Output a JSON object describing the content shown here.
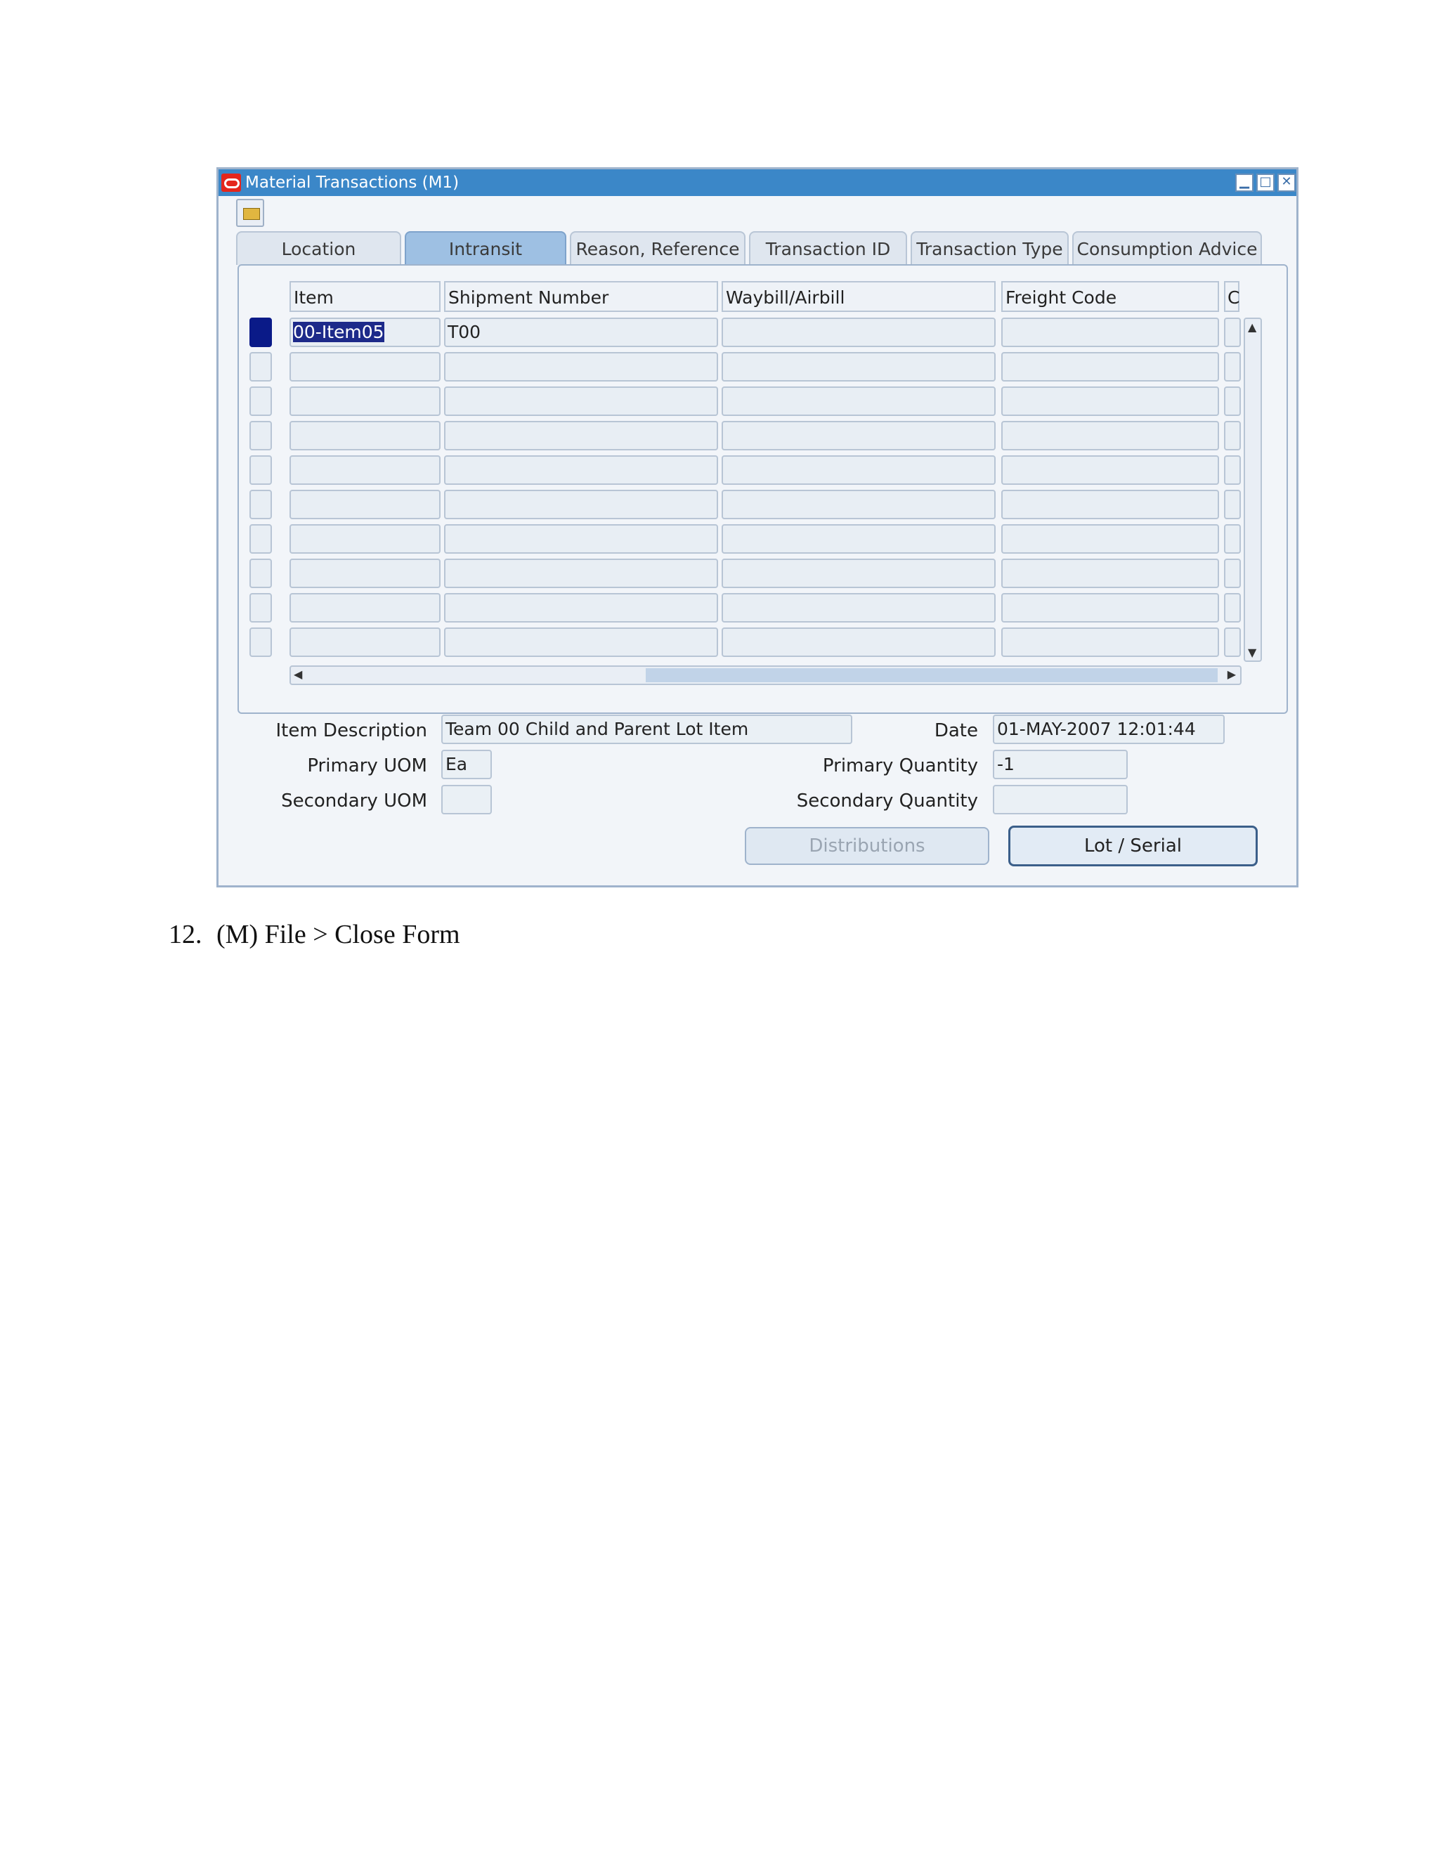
{
  "window": {
    "title": "Material Transactions (M1)",
    "controls": {
      "minimize": "▁",
      "maximize": "□",
      "close": "✕"
    }
  },
  "tabs": [
    {
      "label": "Location",
      "active": false
    },
    {
      "label": "Intransit",
      "active": true
    },
    {
      "label": "Reason, Reference",
      "active": false
    },
    {
      "label": "Transaction ID",
      "active": false
    },
    {
      "label": "Transaction Type",
      "active": false
    },
    {
      "label": "Consumption Advice",
      "active": false
    }
  ],
  "grid": {
    "columns": [
      "Item",
      "Shipment Number",
      "Waybill/Airbill",
      "Freight Code",
      "C"
    ],
    "rows": [
      [
        "00-Item05",
        "T00",
        "",
        "",
        ""
      ],
      [
        "",
        "",
        "",
        "",
        ""
      ],
      [
        "",
        "",
        "",
        "",
        ""
      ],
      [
        "",
        "",
        "",
        "",
        ""
      ],
      [
        "",
        "",
        "",
        "",
        ""
      ],
      [
        "",
        "",
        "",
        "",
        ""
      ],
      [
        "",
        "",
        "",
        "",
        ""
      ],
      [
        "",
        "",
        "",
        "",
        ""
      ],
      [
        "",
        "",
        "",
        "",
        ""
      ],
      [
        "",
        "",
        "",
        "",
        ""
      ]
    ]
  },
  "details": {
    "item_description_label": "Item Description",
    "item_description": "Team 00 Child and Parent Lot Item",
    "date_label": "Date",
    "date": "01-MAY-2007 12:01:44",
    "primary_uom_label": "Primary UOM",
    "primary_uom": "Ea",
    "primary_quantity_label": "Primary Quantity",
    "primary_quantity": "-1",
    "secondary_uom_label": "Secondary UOM",
    "secondary_uom": "",
    "secondary_quantity_label": "Secondary Quantity",
    "secondary_quantity": ""
  },
  "buttons": {
    "distributions": "Distributions",
    "lot_serial": "Lot / Serial"
  },
  "instruction": {
    "number": "12.",
    "text": "(M) File > Close Form"
  }
}
